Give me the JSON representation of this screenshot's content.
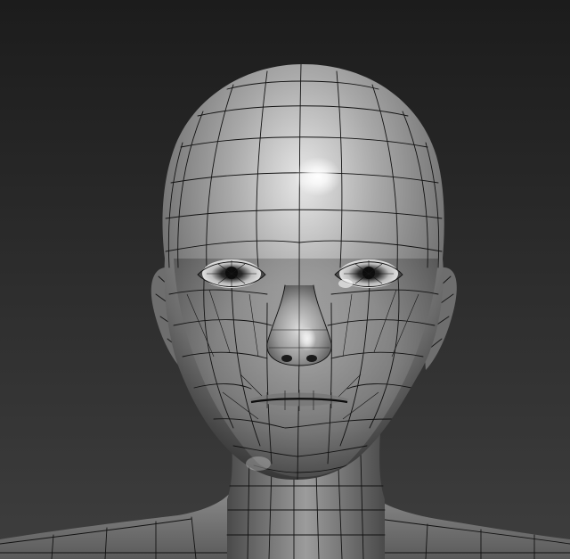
{
  "viewport": {
    "subject": "head-mesh",
    "display_mode": "smooth-shaded-wireframe",
    "colors": {
      "background_top": "#1c1c1c",
      "background_bottom": "#3e3e3e",
      "surface_highlight": "#f2f2f2",
      "surface_mid": "#9a9a9a",
      "surface_shadow": "#2a2a2a",
      "wire": "#121212"
    }
  }
}
